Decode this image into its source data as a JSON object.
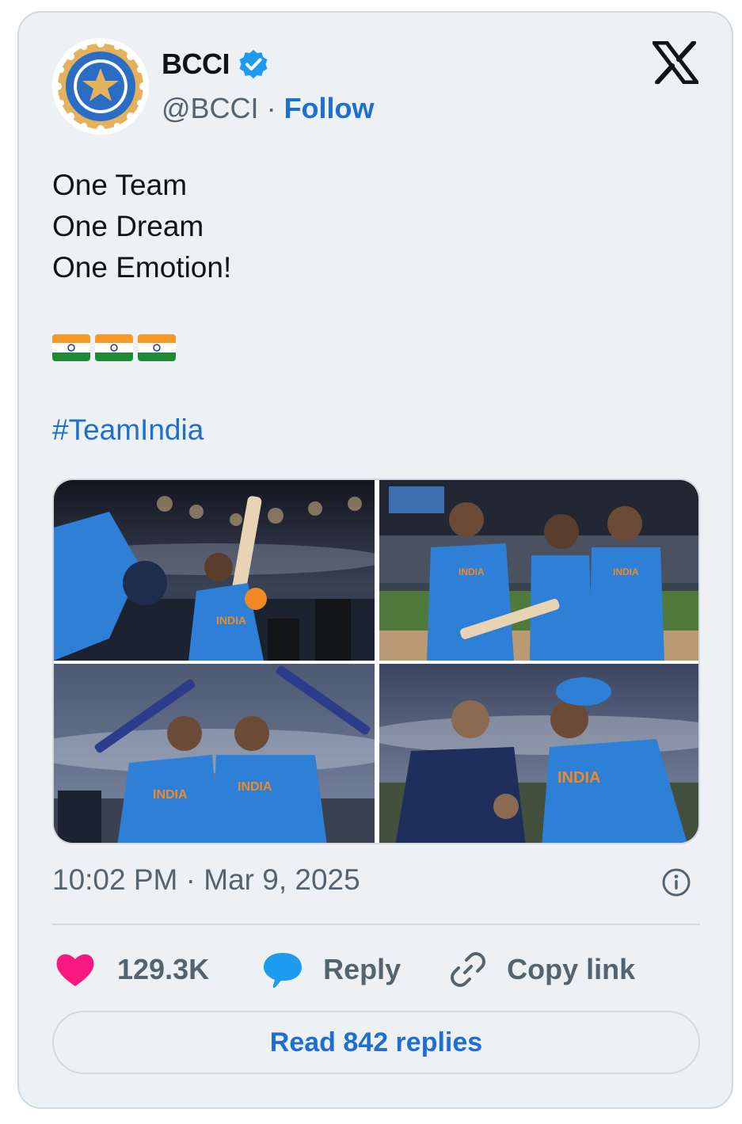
{
  "author": {
    "name": "BCCI",
    "handle": "@BCCI",
    "separator": "·",
    "follow_label": "Follow",
    "verified": true,
    "avatar_icon": "bcci-logo-icon"
  },
  "platform_icon": "x-logo-icon",
  "tweet": {
    "lines": [
      "One Team",
      "One Dream",
      "One Emotion!"
    ],
    "emoji": [
      "india-flag",
      "india-flag",
      "india-flag"
    ],
    "hashtag": "#TeamIndia"
  },
  "media": {
    "photos": [
      {
        "jersey_text": "INDIA"
      },
      {
        "jersey_text": "INDIA"
      },
      {
        "jersey_text": "INDIA"
      },
      {
        "jersey_text": "INDIA"
      }
    ]
  },
  "timestamp": "10:02 PM · Mar 9, 2025",
  "actions": {
    "likes": "129.3K",
    "reply_label": "Reply",
    "copy_label": "Copy link"
  },
  "read_replies_label": "Read 842 replies",
  "colors": {
    "link": "#1d6fd1",
    "like": "#f91880",
    "reply_icon": "#1d9bf0",
    "card_bg": "#edf1f4",
    "border": "#cfd9de",
    "muted": "#536471"
  }
}
